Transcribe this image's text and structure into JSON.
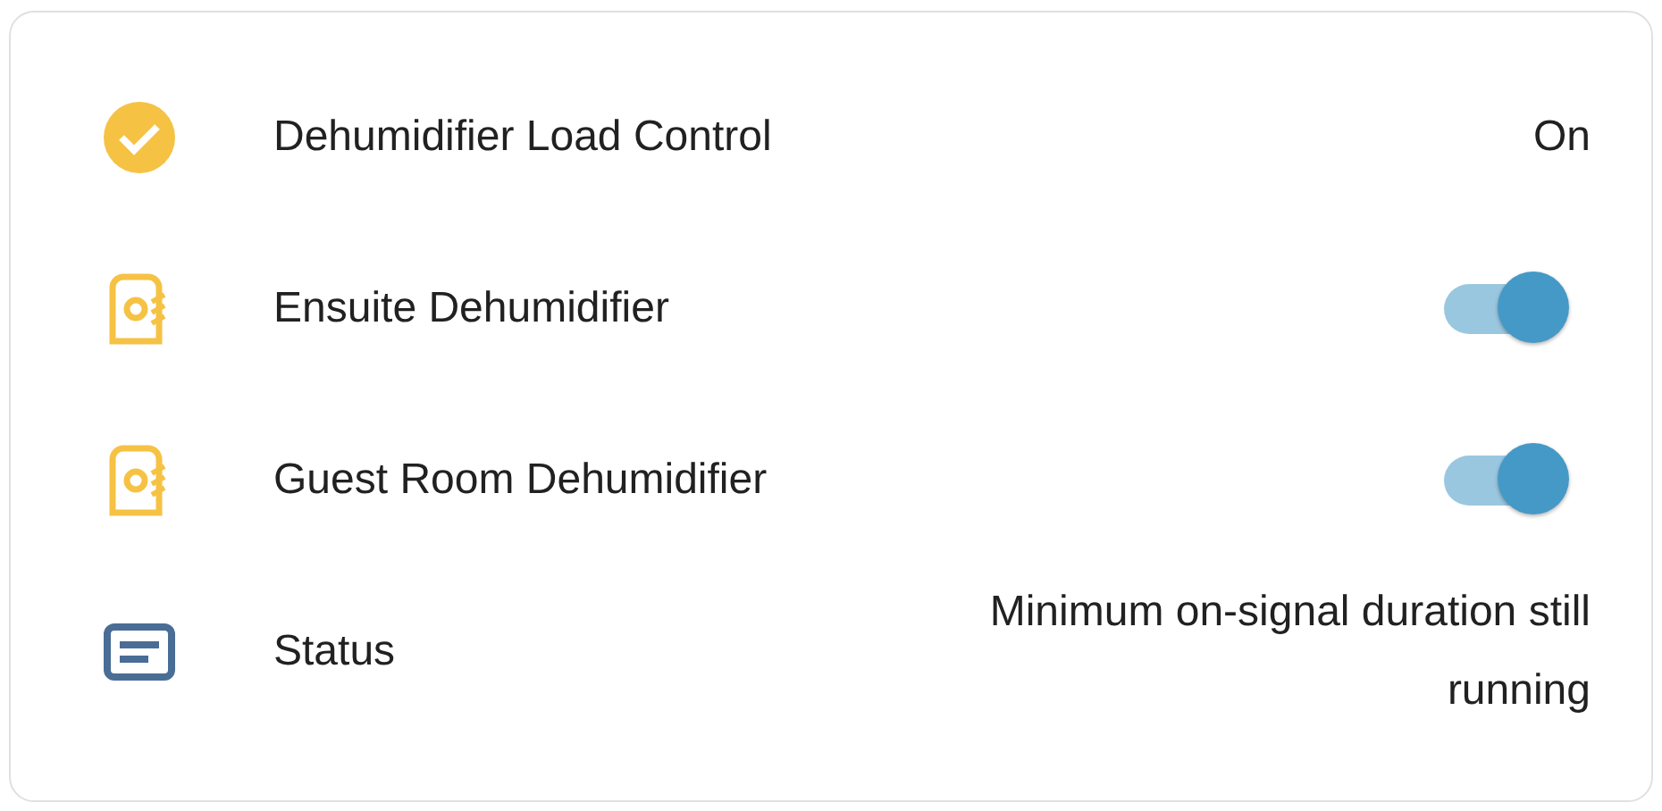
{
  "rows": [
    {
      "kind": "status",
      "name": "Dehumidifier Load Control",
      "value": "On"
    },
    {
      "kind": "toggle",
      "name": "Ensuite Dehumidifier",
      "on": true
    },
    {
      "kind": "toggle",
      "name": "Guest Room Dehumidifier",
      "on": true
    },
    {
      "kind": "text",
      "name": "Status",
      "value": "Minimum on-signal duration still running"
    }
  ]
}
